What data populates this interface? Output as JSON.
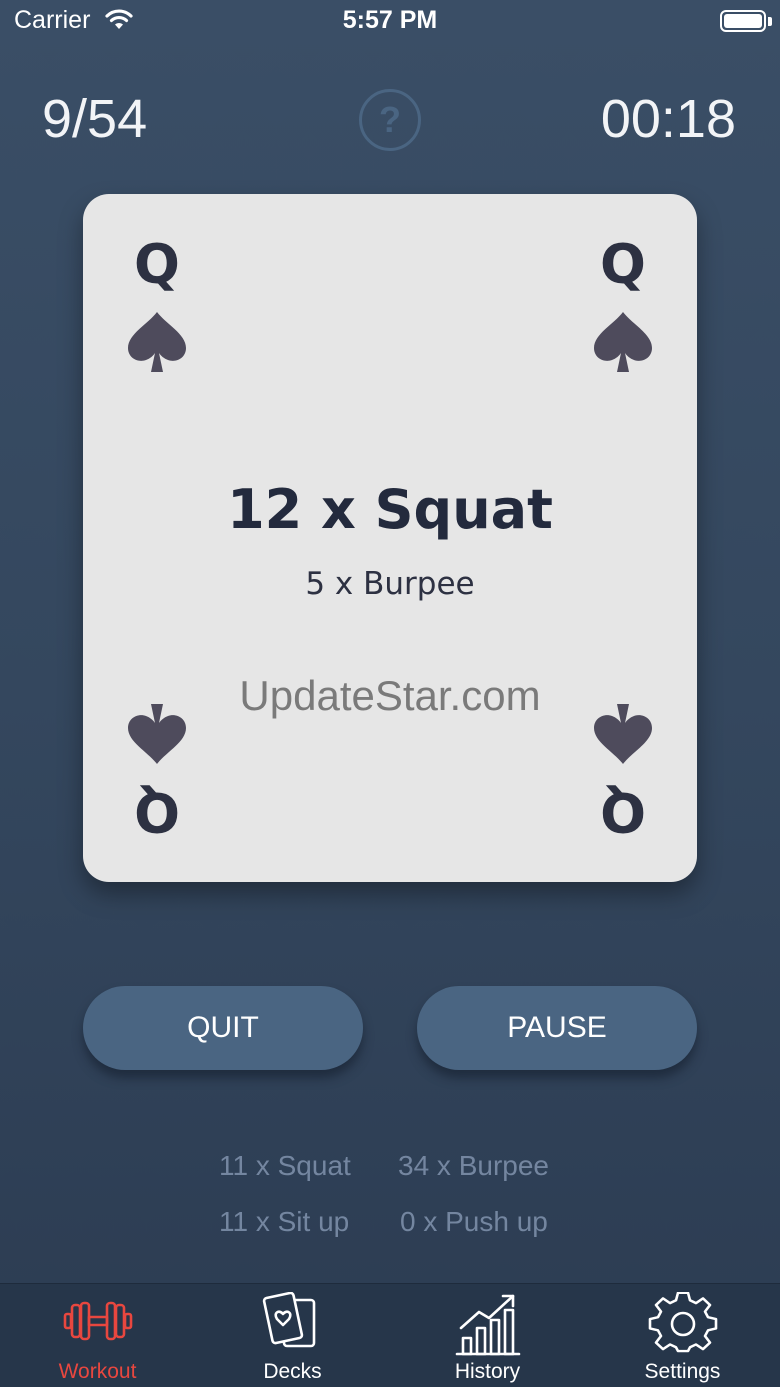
{
  "status_bar": {
    "carrier": "Carrier",
    "time": "5:57 PM"
  },
  "header": {
    "progress": "9/54",
    "help_label": "?",
    "timer": "00:18"
  },
  "card": {
    "rank": "Q",
    "suit_icon": "spade-icon",
    "main_exercise": "12 x Squat",
    "secondary_exercise": "5 x Burpee",
    "watermark": "UpdateStar.com",
    "suit_color": "#4e4b5c"
  },
  "buttons": {
    "quit": "QUIT",
    "pause": "PAUSE"
  },
  "stats": [
    "11 x Squat",
    "34 x Burpee",
    "11 x Sit up",
    "0 x Push up"
  ],
  "tabs": [
    {
      "label": "Workout",
      "icon": "dumbbell-icon",
      "active": true
    },
    {
      "label": "Decks",
      "icon": "cards-icon",
      "active": false
    },
    {
      "label": "History",
      "icon": "chart-icon",
      "active": false
    },
    {
      "label": "Settings",
      "icon": "gear-icon",
      "active": false
    }
  ],
  "colors": {
    "accent": "#e8473f",
    "button": "#4a6582",
    "tab_bar": "#26364a"
  }
}
